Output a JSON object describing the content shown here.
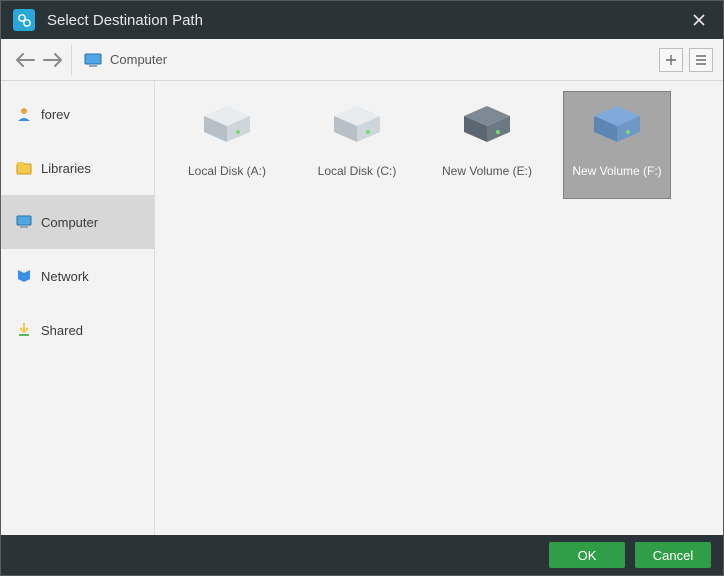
{
  "window": {
    "title": "Select Destination Path"
  },
  "path": {
    "current": "Computer"
  },
  "sidebar": {
    "items": [
      {
        "label": "forev"
      },
      {
        "label": "Libraries"
      },
      {
        "label": "Computer"
      },
      {
        "label": "Network"
      },
      {
        "label": "Shared"
      }
    ]
  },
  "drives": [
    {
      "label": "Local Disk (A:)",
      "selected": false,
      "tint": "light"
    },
    {
      "label": "Local Disk (C:)",
      "selected": false,
      "tint": "light"
    },
    {
      "label": "New Volume (E:)",
      "selected": false,
      "tint": "dark"
    },
    {
      "label": "New Volume (F:)",
      "selected": true,
      "tint": "blue"
    }
  ],
  "footer": {
    "ok": "OK",
    "cancel": "Cancel"
  }
}
